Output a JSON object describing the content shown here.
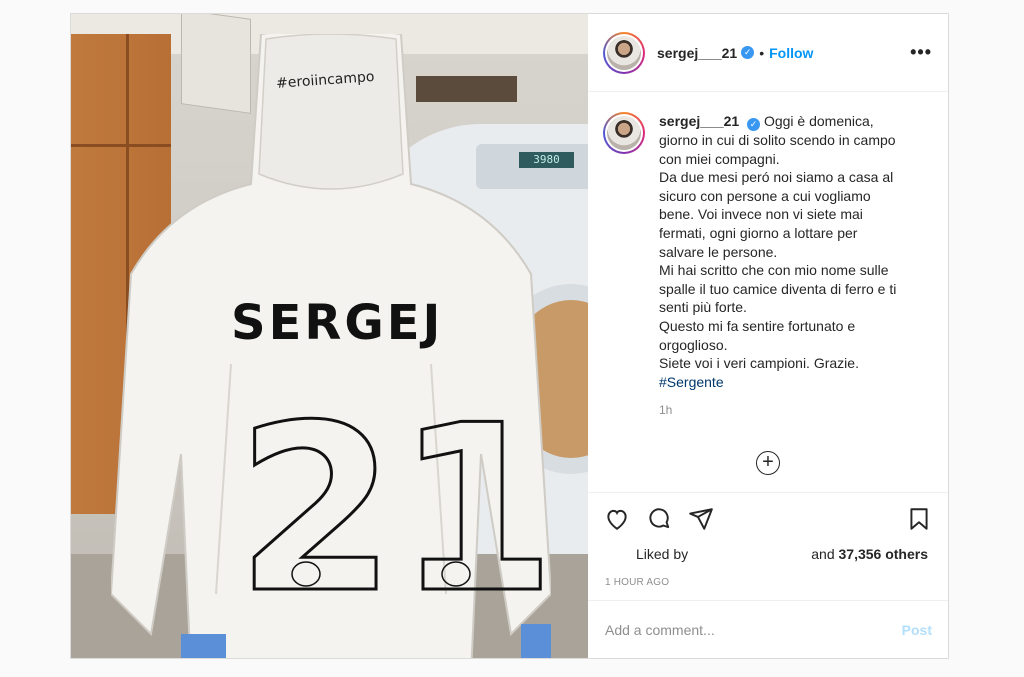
{
  "post": {
    "username": "sergej___21",
    "verified": true,
    "follow_label": "Follow",
    "dot": "•",
    "more_label": "•••",
    "image": {
      "suit_name": "SERGEJ",
      "suit_number": "21",
      "hood_text": "#eroiincampo",
      "display_value": "3980"
    },
    "caption": {
      "text": "Oggi è domenica, giorno in cui di solito scendo in campo con miei compagni.\nDa due mesi peró noi siamo a casa al sicuro con persone a cui vogliamo bene. Voi invece non vi siete mai fermati, ogni giorno a lottare per salvare le persone.\nMi hai scritto che con mio nome sulle spalle il tuo camice diventa di ferro e ti senti più forte.\nQuesto mi fa sentire fortunato e orgoglioso.\nSiete voi i veri campioni. Grazie.\n",
      "hashtag": "#Sergente",
      "time": "1h"
    },
    "plus_label": "+",
    "likes": {
      "liked_by": "Liked by",
      "and_label": "and",
      "others_count": "37,356 others"
    },
    "posted_ago": "1 HOUR AGO",
    "comment_input": {
      "placeholder": "Add a comment...",
      "post_label": "Post"
    },
    "colors": {
      "accent": "#0095f6",
      "verified": "#3897f0",
      "post_disabled": "#b2dffc"
    },
    "icons": [
      "heart-icon",
      "comment-icon",
      "share-icon",
      "bookmark-icon",
      "add-comment-icon"
    ]
  }
}
